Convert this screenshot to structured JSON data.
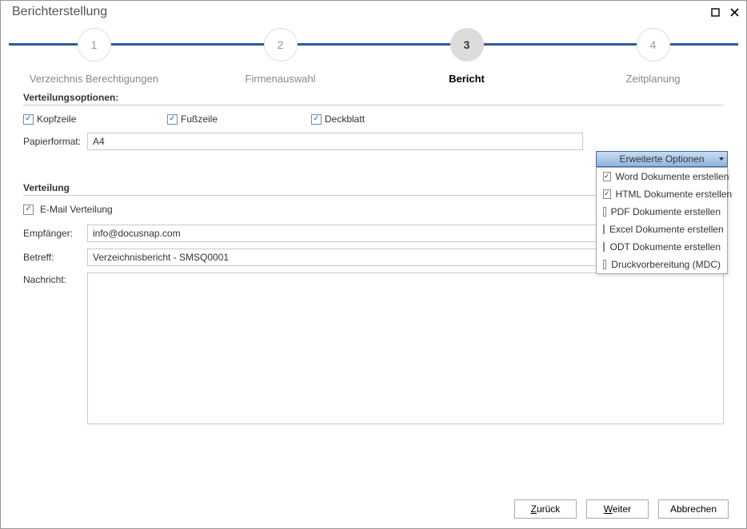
{
  "window": {
    "title": "Berichterstellung"
  },
  "stepper": {
    "steps": [
      {
        "num": "1",
        "label": "Verzeichnis Berechtigungen"
      },
      {
        "num": "2",
        "label": "Firmenauswahl"
      },
      {
        "num": "3",
        "label": "Bericht"
      },
      {
        "num": "4",
        "label": "Zeitplanung"
      }
    ],
    "active_index": 2
  },
  "distribution_options": {
    "header": "Verteilungsoptionen:",
    "checkboxes": {
      "kopfzeile": "Kopfzeile",
      "fusszeile": "Fußzeile",
      "deckblatt": "Deckblatt"
    },
    "paperformat_label": "Papierformat:",
    "paperformat_value": "A4",
    "adv_button": "Erweiterte Optionen",
    "adv_items": [
      {
        "label": "Word Dokumente erstellen",
        "checked": true
      },
      {
        "label": "HTML Dokumente erstellen",
        "checked": true
      },
      {
        "label": "PDF Dokumente  erstellen",
        "checked": false
      },
      {
        "label": "Excel Dokumente erstellen",
        "checked": false
      },
      {
        "label": "ODT Dokumente  erstellen",
        "checked": false
      },
      {
        "label": "Druckvorbereitung (MDC)",
        "checked": false
      }
    ]
  },
  "distribution": {
    "header": "Verteilung",
    "email_checkbox": "E-Mail Verteilung",
    "recipient_label": "Empfänger:",
    "recipient_value": "info@docusnap.com",
    "subject_label": "Betreff:",
    "subject_value": "Verzeichnisbericht - SMSQ0001",
    "message_label": "Nachricht:",
    "message_value": ""
  },
  "footer": {
    "back": "Zurück",
    "next": "Weiter",
    "cancel": "Abbrechen"
  }
}
